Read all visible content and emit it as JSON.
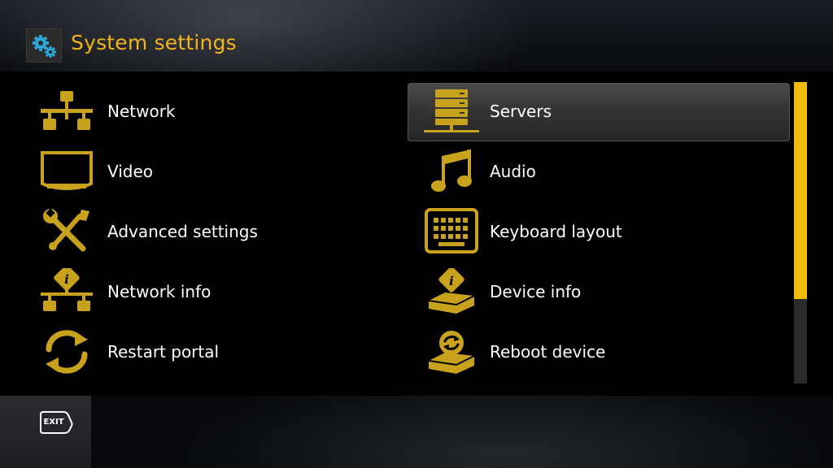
{
  "header": {
    "title": "System settings",
    "icon": "gears-icon"
  },
  "menu": {
    "items": [
      {
        "label": "Network",
        "icon": "network-icon"
      },
      {
        "label": "Servers",
        "icon": "servers-icon",
        "selected": true
      },
      {
        "label": "Video",
        "icon": "video-icon"
      },
      {
        "label": "Audio",
        "icon": "audio-icon"
      },
      {
        "label": "Advanced settings",
        "icon": "tools-icon"
      },
      {
        "label": "Keyboard layout",
        "icon": "keyboard-icon"
      },
      {
        "label": "Network info",
        "icon": "network-info-icon"
      },
      {
        "label": "Device info",
        "icon": "device-info-icon"
      },
      {
        "label": "Restart portal",
        "icon": "restart-icon"
      },
      {
        "label": "Reboot device",
        "icon": "reboot-device-icon"
      }
    ]
  },
  "scrollbar": {
    "position_fraction": 0,
    "visible_fraction": 0.72
  },
  "footer": {
    "exit_label": "EXIT"
  },
  "colors": {
    "accent": "#f2b417",
    "icon": "#c9a21d",
    "highlight": "#3a3a3a",
    "scrollbar_track": "#2c2c2e",
    "scrollbar_thumb": "#f0bd0e"
  }
}
